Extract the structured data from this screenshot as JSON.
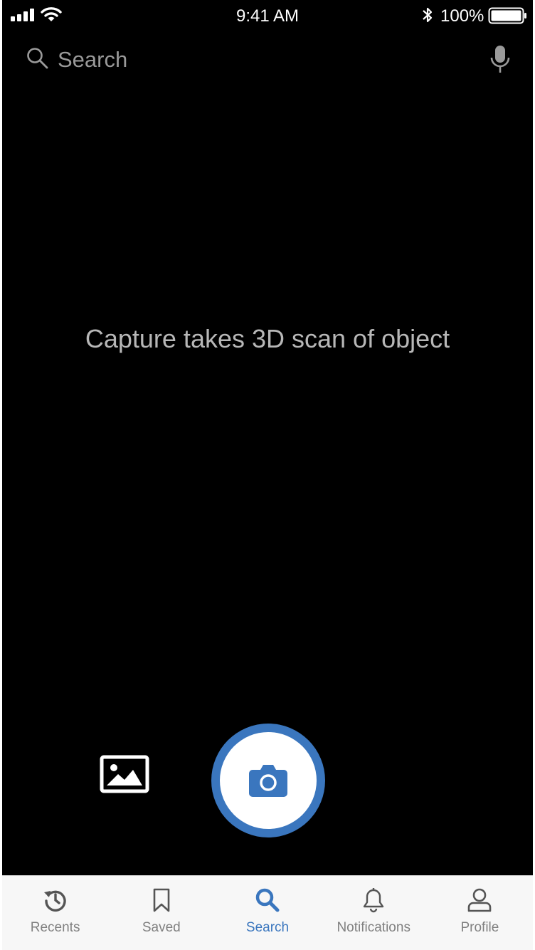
{
  "status_bar": {
    "time": "9:41 AM",
    "battery_percent": "100%",
    "battery_level": 1.0
  },
  "search": {
    "placeholder": "Search"
  },
  "main": {
    "message": "Capture takes 3D scan of object"
  },
  "colors": {
    "accent": "#3a76be",
    "background": "#000000",
    "tab_inactive": "#808080"
  },
  "tabs": [
    {
      "label": "Recents",
      "icon": "history-icon",
      "active": false
    },
    {
      "label": "Saved",
      "icon": "bookmark-icon",
      "active": false
    },
    {
      "label": "Search",
      "icon": "search-icon",
      "active": true
    },
    {
      "label": "Notifications",
      "icon": "bell-icon",
      "active": false
    },
    {
      "label": "Profile",
      "icon": "person-icon",
      "active": false
    }
  ]
}
